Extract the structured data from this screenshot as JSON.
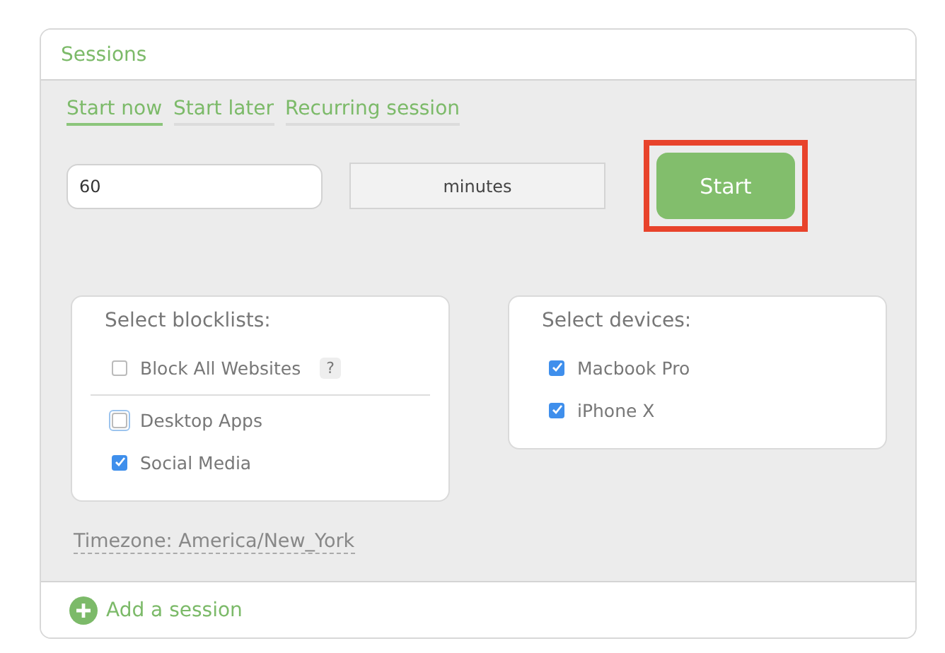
{
  "panel": {
    "title": "Sessions"
  },
  "tabs": [
    {
      "label": "Start now",
      "selected": true
    },
    {
      "label": "Start later",
      "selected": false
    },
    {
      "label": "Recurring session",
      "selected": false
    }
  ],
  "duration": {
    "value": "60",
    "unit": "minutes"
  },
  "start_button": {
    "label": "Start",
    "highlighted": true
  },
  "blocklists": {
    "heading": "Select blocklists:",
    "items": [
      {
        "label": "Block All Websites",
        "checked": false,
        "help": "?"
      },
      {
        "label": "Desktop Apps",
        "checked": false,
        "focused": true
      },
      {
        "label": "Social Media",
        "checked": true
      }
    ]
  },
  "devices": {
    "heading": "Select devices:",
    "items": [
      {
        "label": "Macbook Pro",
        "checked": true
      },
      {
        "label": "iPhone X",
        "checked": true
      }
    ]
  },
  "timezone": "Timezone: America/New_York",
  "add_session": "Add a session"
}
